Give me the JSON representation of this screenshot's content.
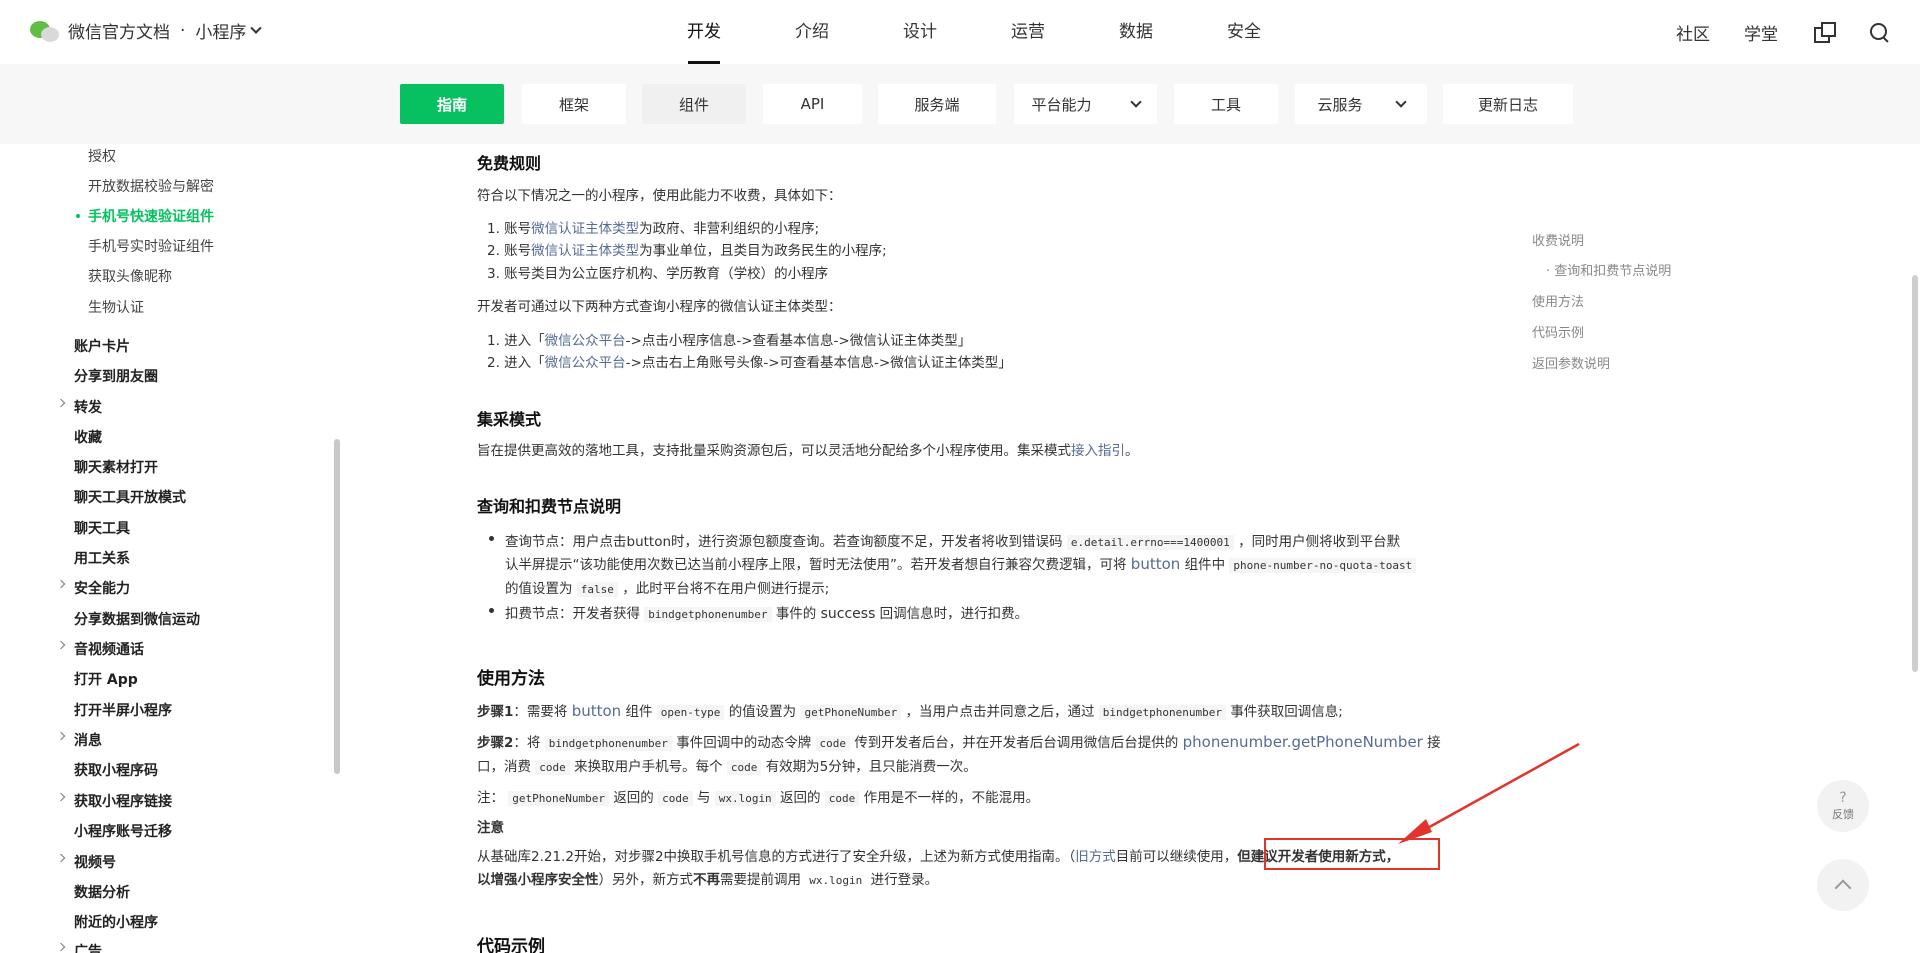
{
  "header": {
    "brand": "微信官方文档",
    "separator": "·",
    "product": "小程序",
    "nav": [
      "开发",
      "介绍",
      "设计",
      "运营",
      "数据",
      "安全"
    ],
    "active_nav": "开发",
    "right": [
      "社区",
      "学堂"
    ],
    "icons": [
      "external-link-icon",
      "search-icon"
    ]
  },
  "subnav": {
    "items": [
      "指南",
      "框架",
      "组件",
      "API",
      "服务端",
      "平台能力",
      "工具",
      "云服务",
      "更新日志"
    ],
    "active": "指南",
    "accent": "#07c160"
  },
  "sidebar": {
    "sub_items": [
      "授权",
      "开放数据校验与解密",
      "手机号快速验证组件",
      "手机号实时验证组件",
      "获取头像昵称",
      "生物认证"
    ],
    "active_item": "手机号快速验证组件",
    "top_items": [
      "账户卡片",
      "分享到朋友圈",
      "转发",
      "收藏",
      "聊天素材打开",
      "聊天工具开放模式",
      "聊天工具",
      "用工关系",
      "安全能力",
      "分享数据到微信运动",
      "音视频通话",
      "打开 App",
      "打开半屏小程序",
      "消息",
      "获取小程序码",
      "获取小程序链接",
      "小程序账号迁移",
      "视频号",
      "数据分析",
      "附近的小程序",
      "广告"
    ]
  },
  "content": {
    "free_rules": {
      "title": "免费规则",
      "intro": "符合以下情况之一的小程序，使用此能力不收费，具体如下：",
      "list": [
        {
          "pre": "1. 账号",
          "link": "微信认证主体类型",
          "post": "为政府、非营利组织的小程序;"
        },
        {
          "pre": "2. 账号",
          "link": "微信认证主体类型",
          "post": "为事业单位，且类目为政务民生的小程序;"
        },
        {
          "pre": "3. 账号类目为公立医疗机构、学历教育（学校）的小程序",
          "link": "",
          "post": ""
        }
      ],
      "query_intro": "开发者可通过以下两种方式查询小程序的微信认证主体类型：",
      "query_list": [
        {
          "pre": "1. 进入「",
          "link": "微信公众平台",
          "post": "->点击小程序信息->查看基本信息->微信认证主体类型」"
        },
        {
          "pre": "2. 进入「",
          "link": "微信公众平台",
          "post": "->点击右上角账号头像->可查看基本信息->微信认证主体类型」"
        }
      ]
    },
    "collect": {
      "title": "集采模式",
      "text": "旨在提供更高效的落地工具，支持批量采购资源包后，可以灵活地分配给多个小程序使用。集采模式",
      "link": "接入指引",
      "end": "。"
    },
    "query_deduct": {
      "title": "查询和扣费节点说明",
      "b1_a": "查询节点：用户点击button时，进行资源包额度查询。若查询额度不足，开发者将收到错误码",
      "b1_code": "e.detail.errno===1400001",
      "b1_b": "，同时用户侧将收到平台默",
      "b2_a": "认半屏提示“该功能使用次数已达当前小程序上限，暂时无法使用”。若开发者想自行兼容欠费逻辑，可将",
      "b2_link": "button",
      "b2_b": "组件中",
      "b2_code": "phone-number-no-quota-toast",
      "b3_a": "的值设置为",
      "b3_code": "false",
      "b3_b": "，此时平台将不在用户侧进行提示;",
      "b4_a": "扣费节点：开发者获得",
      "b4_code": "bindgetphonenumber",
      "b4_b": "事件的",
      "b4_c": "success",
      "b4_d": "回调信息时，进行扣费。"
    },
    "usage": {
      "title": "使用方法",
      "s1_label": "步骤1",
      "s1_a": "：需要将",
      "s1_link": "button",
      "s1_b": "组件",
      "s1_code1": "open-type",
      "s1_c": "的值设置为",
      "s1_code2": "getPhoneNumber",
      "s1_d": "，当用户点击并同意之后，通过",
      "s1_code3": "bindgetphonenumber",
      "s1_e": "事件获取回调信息;",
      "s2_label": "步骤2",
      "s2_a": "：将",
      "s2_code1": "bindgetphonenumber",
      "s2_b": "事件回调中的动态令牌",
      "s2_code2": "code",
      "s2_c": "传到开发者后台，并在开发者后台调用微信后台提供的",
      "s2_link": "phonenumber.getPhoneNumber",
      "s2_d": "接",
      "s2_e": "口，消费",
      "s2_code3": "code",
      "s2_f": "来换取用户手机号。每个",
      "s2_code4": "code",
      "s2_g": "有效期为5分钟，且只能消费一次。",
      "note_a": "注：",
      "note_code1": "getPhoneNumber",
      "note_b": "返回的",
      "note_code2": "code",
      "note_c": "与",
      "note_code3": "wx.login",
      "note_d": "返回的",
      "note_code4": "code",
      "note_e": "作用是不一样的，不能混用。",
      "attention": "注意",
      "att_a": "从基础库2.21.2开始，对步骤2中换取手机号信息的方式进行了安全升级，上述为新方式使用指南。（",
      "att_link": "旧方式",
      "att_b": "目前可以继续使用，",
      "att_bold1": "但建议开发者使用新方式，",
      "att_bold2": "以增强小程序安全性",
      "att_c": "）另外，新方式",
      "att_bold3": "不再",
      "att_d": "需要提前调用",
      "att_code": "wx.login",
      "att_e": "进行登录。"
    },
    "code_title": "代码示例"
  },
  "toc": {
    "items": [
      "收费说明",
      "· 查询和扣费节点说明",
      "使用方法",
      "代码示例",
      "返回参数说明"
    ]
  },
  "floating": {
    "feedback_symbol": "?",
    "feedback": "反馈"
  },
  "annotation_color": "#e0342c"
}
